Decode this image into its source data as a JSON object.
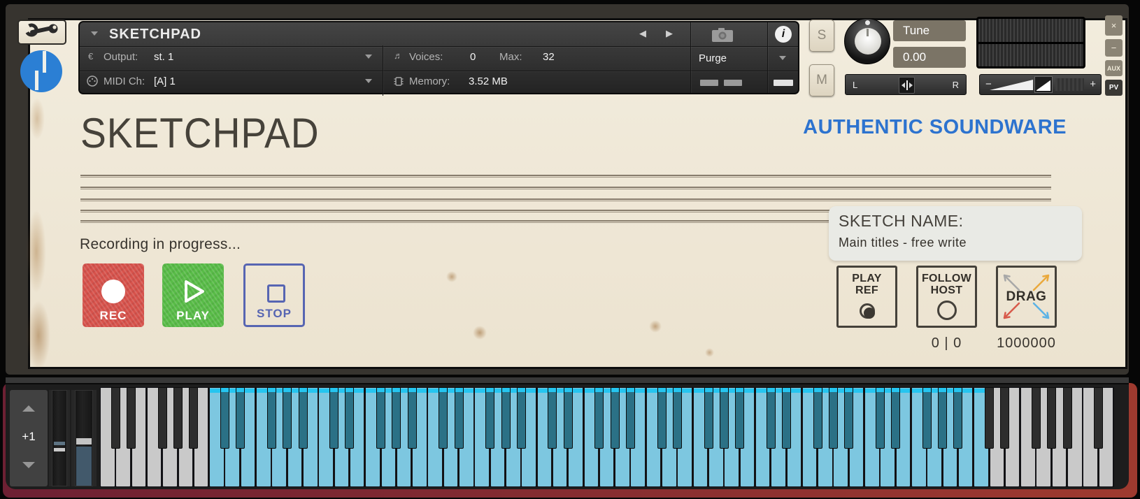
{
  "header": {
    "instrument_name": "SKETCHPAD",
    "output_label": "Output:",
    "output_value": "st. 1",
    "voices_label": "Voices:",
    "voices_value": "0",
    "max_label": "Max:",
    "max_value": "32",
    "midi_label": "MIDI Ch:",
    "midi_value": "[A] 1",
    "memory_label": "Memory:",
    "memory_value": "3.52 MB",
    "purge_label": "Purge",
    "nav_prev": "◀",
    "nav_next": "▶",
    "output_icon": "€",
    "voices_icon": "♬",
    "info_glyph": "i",
    "solo_label": "S",
    "mute_label": "M",
    "tune_label": "Tune",
    "tune_value": "0.00",
    "pan_left": "L",
    "pan_right": "R",
    "vol_minus": "−",
    "vol_plus": "+",
    "close_label": "×",
    "minimize_label": "−",
    "aux_label": "AUX",
    "pv_label": "PV"
  },
  "main": {
    "title": "SKETCHPAD",
    "brand": "AUTHENTIC SOUNDWARE",
    "status": "Recording in progress...",
    "rec_label": "REC",
    "play_label": "PLAY",
    "stop_label": "STOP",
    "sketch_label": "SKETCH NAME:",
    "sketch_name": "Main titles - free write",
    "play_ref_line1": "PLAY",
    "play_ref_line2": "REF",
    "follow_host_line1": "FOLLOW",
    "follow_host_line2": "HOST",
    "drag_label": "DRAG",
    "counter_value": "0 | 0",
    "drag_value": "1000000"
  },
  "keyboard": {
    "octave_shift": "+1",
    "white_key_count": 65,
    "highlight_start": 7,
    "highlight_count": 50
  },
  "colors": {
    "accent_blue": "#2d73cf",
    "logo_blue": "#2b7fd4",
    "rec_red": "#d7524b",
    "play_green": "#58bc47",
    "stop_blue": "#5765b2",
    "key_blue": "#7dc7e0",
    "key_blue_dark": "#2b7186",
    "key_cap_cyan": "#25c5f0",
    "maroon_edge": "#8a2c31"
  }
}
